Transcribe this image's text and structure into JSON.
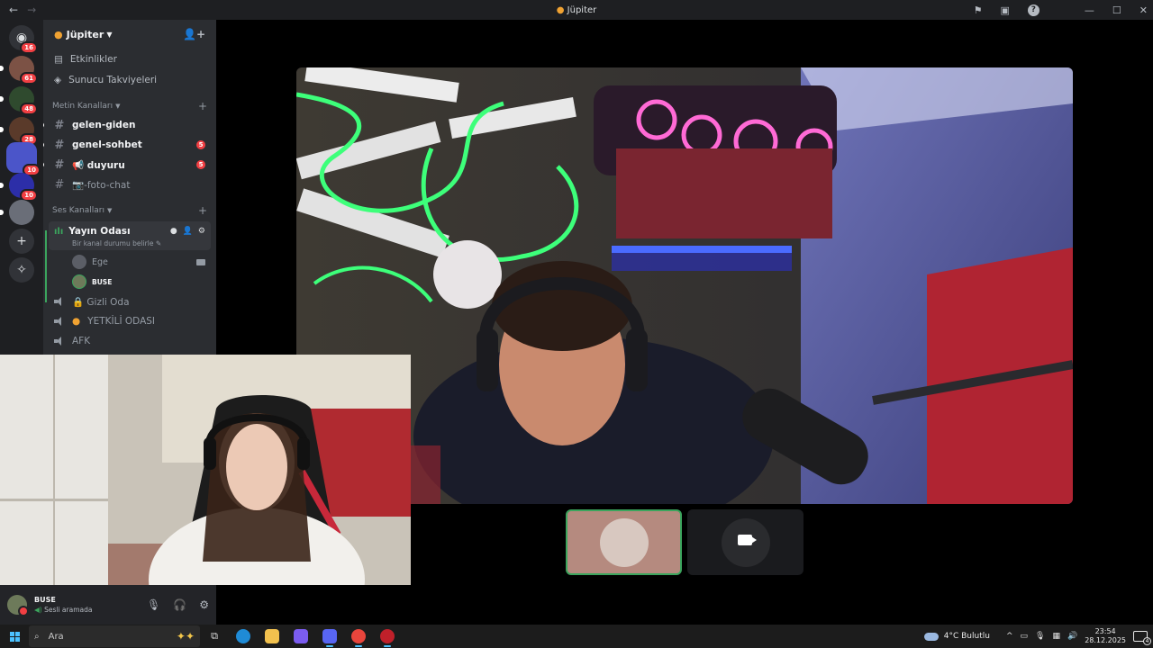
{
  "window": {
    "title": "Jüpiter"
  },
  "server": {
    "name": "Jüpiter"
  },
  "rail": {
    "badges": [
      "16",
      "61",
      "48",
      "28",
      "10",
      "10"
    ]
  },
  "sidebar": {
    "menu": [
      {
        "label": "Etkinlikler"
      },
      {
        "label": "Sunucu Takviyeleri"
      }
    ],
    "text_category": "Metin Kanalları",
    "text_channels": [
      {
        "label": "gelen-giden",
        "count": ""
      },
      {
        "label": "genel-sohbet",
        "count": "5"
      },
      {
        "label": "📢 duyuru",
        "count": "5"
      },
      {
        "label": "📷-foto-chat",
        "count": ""
      }
    ],
    "voice_category": "Ses Kanalları",
    "active_voice": {
      "label": "Yayın Odası",
      "status": "Bir kanal durumu belirle"
    },
    "members": [
      {
        "name": "Ege"
      },
      {
        "name": "BUSE"
      }
    ],
    "voice_channels": [
      {
        "label": "🔒 Gizli Oda"
      },
      {
        "label": "YETKİLİ ODASI"
      },
      {
        "label": "AFK"
      }
    ]
  },
  "user": {
    "name": "BUSE",
    "status": "Sesli aramada"
  },
  "taskbar": {
    "search_placeholder": "Ara",
    "weather": "4°C  Bulutlu",
    "time": "23:54",
    "date": "28.12.2025",
    "notif_count": "4"
  },
  "colors": {
    "accent_green": "#3ba55d",
    "badge_red": "#f23f43"
  }
}
